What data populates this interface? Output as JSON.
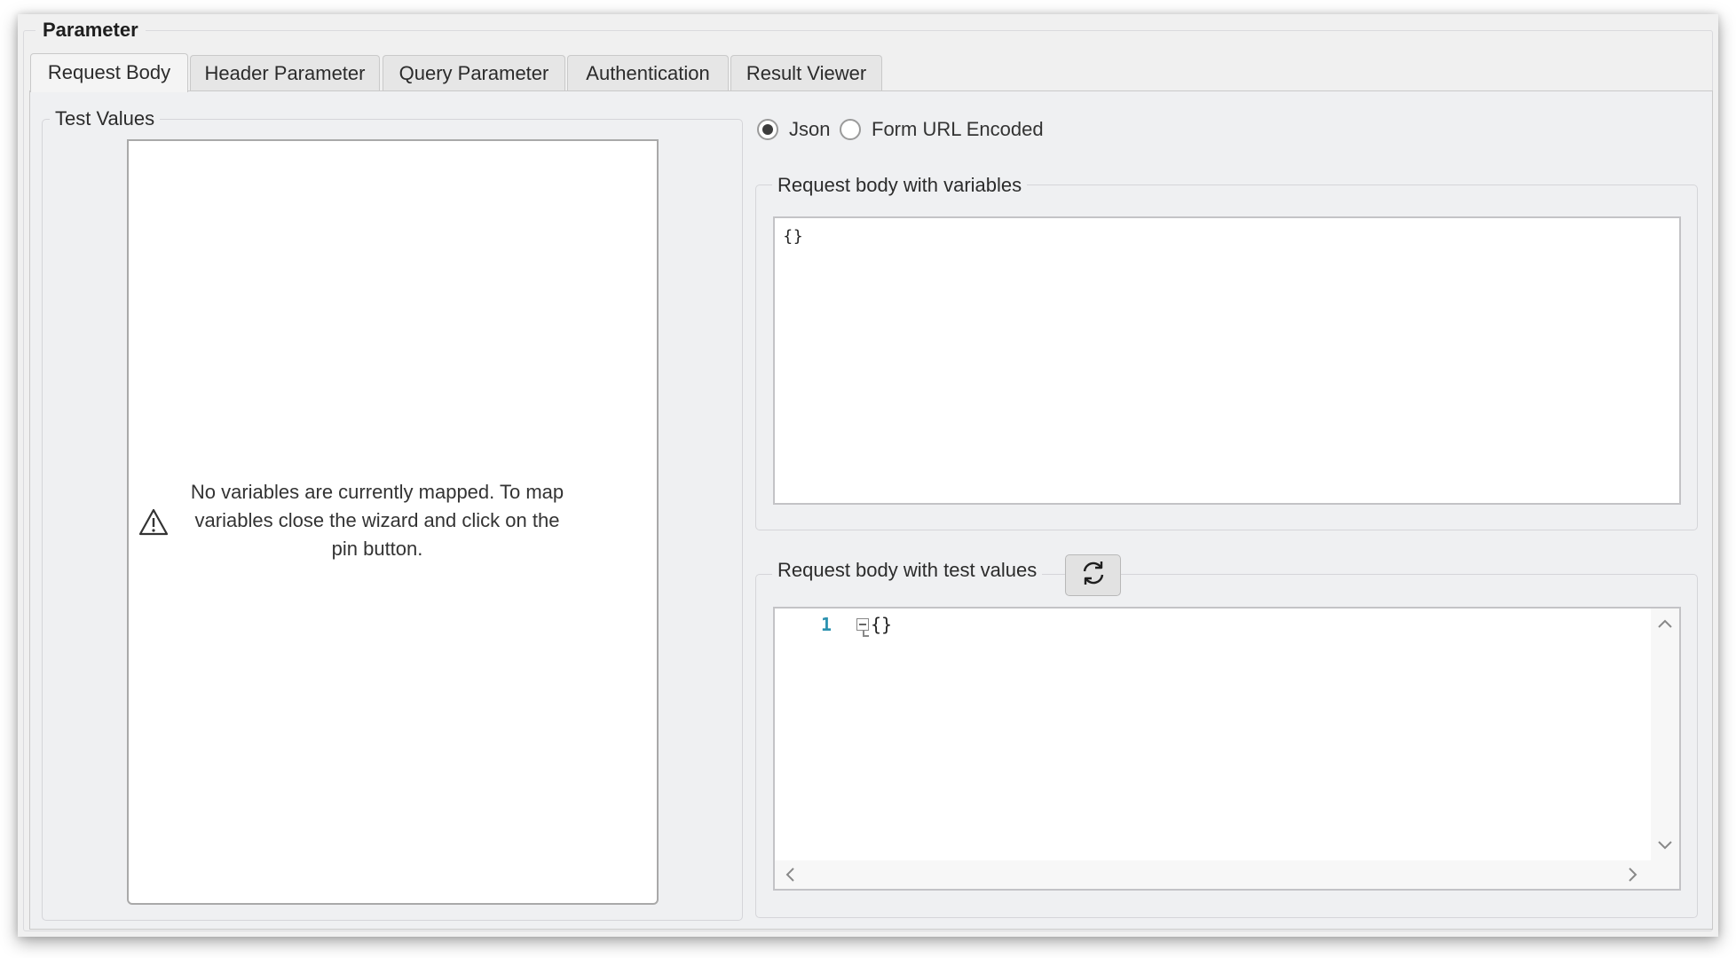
{
  "group": {
    "title": "Parameter"
  },
  "tabs": [
    {
      "label": "Request Body",
      "active": true
    },
    {
      "label": "Header Parameter",
      "active": false
    },
    {
      "label": "Query Parameter",
      "active": false
    },
    {
      "label": "Authentication",
      "active": false
    },
    {
      "label": "Result Viewer",
      "active": false
    }
  ],
  "test_values": {
    "title": "Test Values",
    "empty_message": "No variables are currently mapped. To map variables close the wizard and click on the pin button.",
    "empty_message_lines": [
      "No variables are currently mapped. To map",
      "variables close the wizard and click on the",
      "pin button."
    ],
    "icon": "warning-icon"
  },
  "body_format": {
    "options": [
      {
        "label": "Json",
        "checked": true
      },
      {
        "label": "Form URL Encoded",
        "checked": false
      }
    ]
  },
  "request_body_variables": {
    "title": "Request body with variables",
    "content": "{}"
  },
  "request_body_test_values": {
    "title": "Request body with test values",
    "refresh_icon": "refresh-icon",
    "line_number": "1",
    "content": "{}",
    "colors": {
      "line_number": "#2b91af"
    }
  }
}
